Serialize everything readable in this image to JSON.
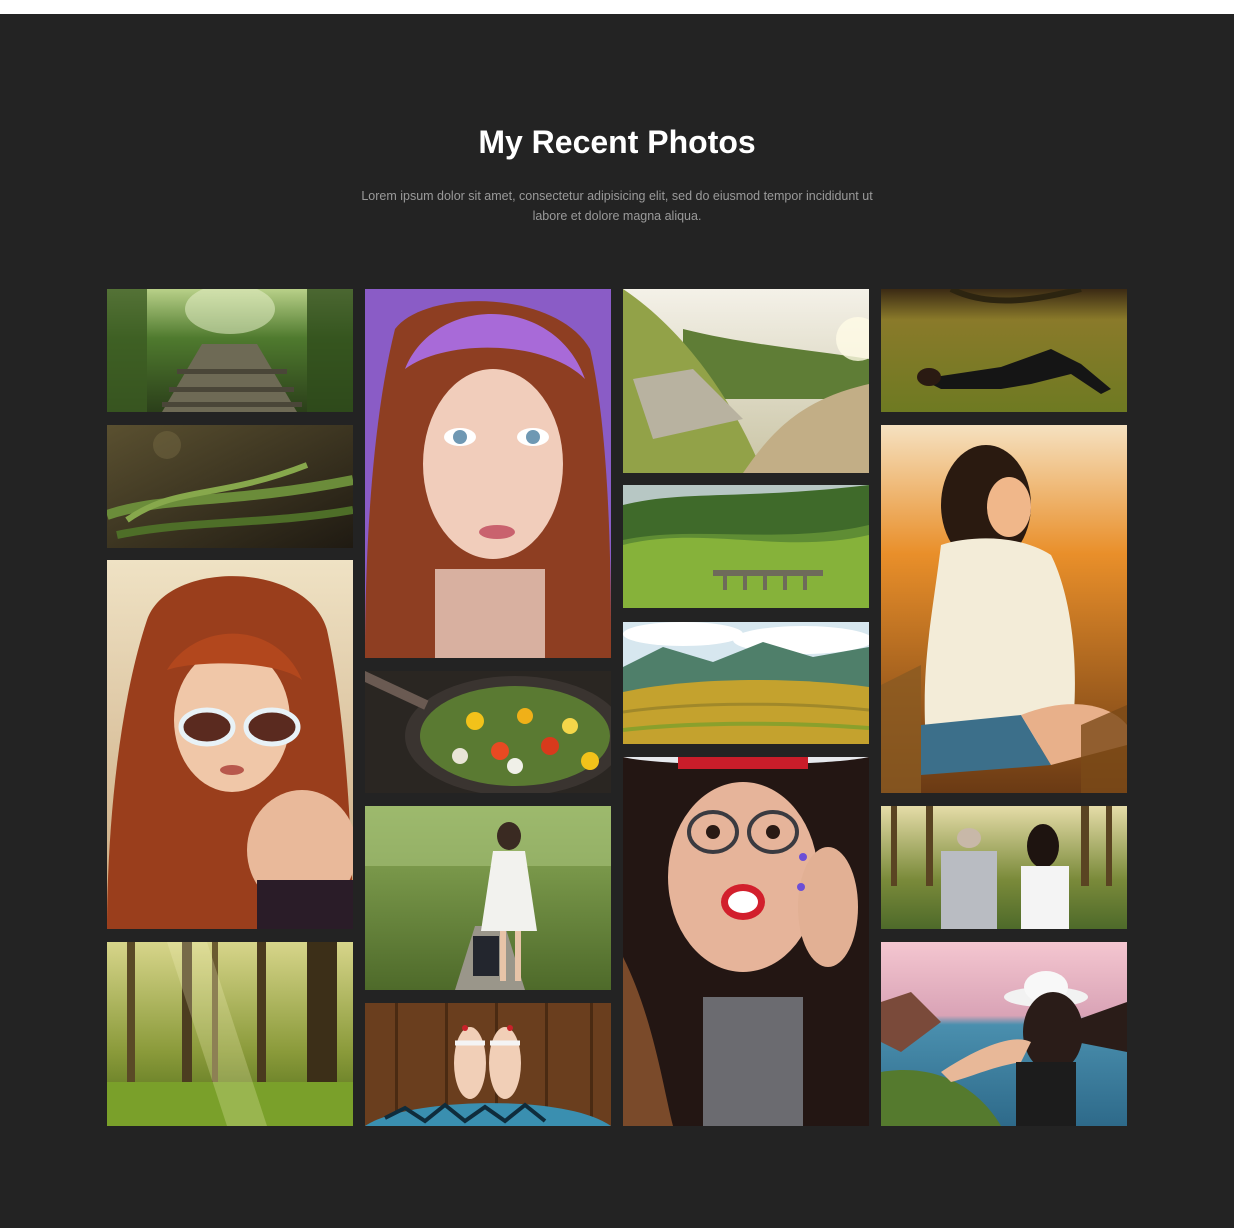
{
  "section": {
    "title": "My Recent Photos",
    "subtitle": "Lorem ipsum dolor sit amet, consectetur adipisicing elit, sed do eiusmod tempor incididunt ut labore et dolore magna aliqua."
  }
}
